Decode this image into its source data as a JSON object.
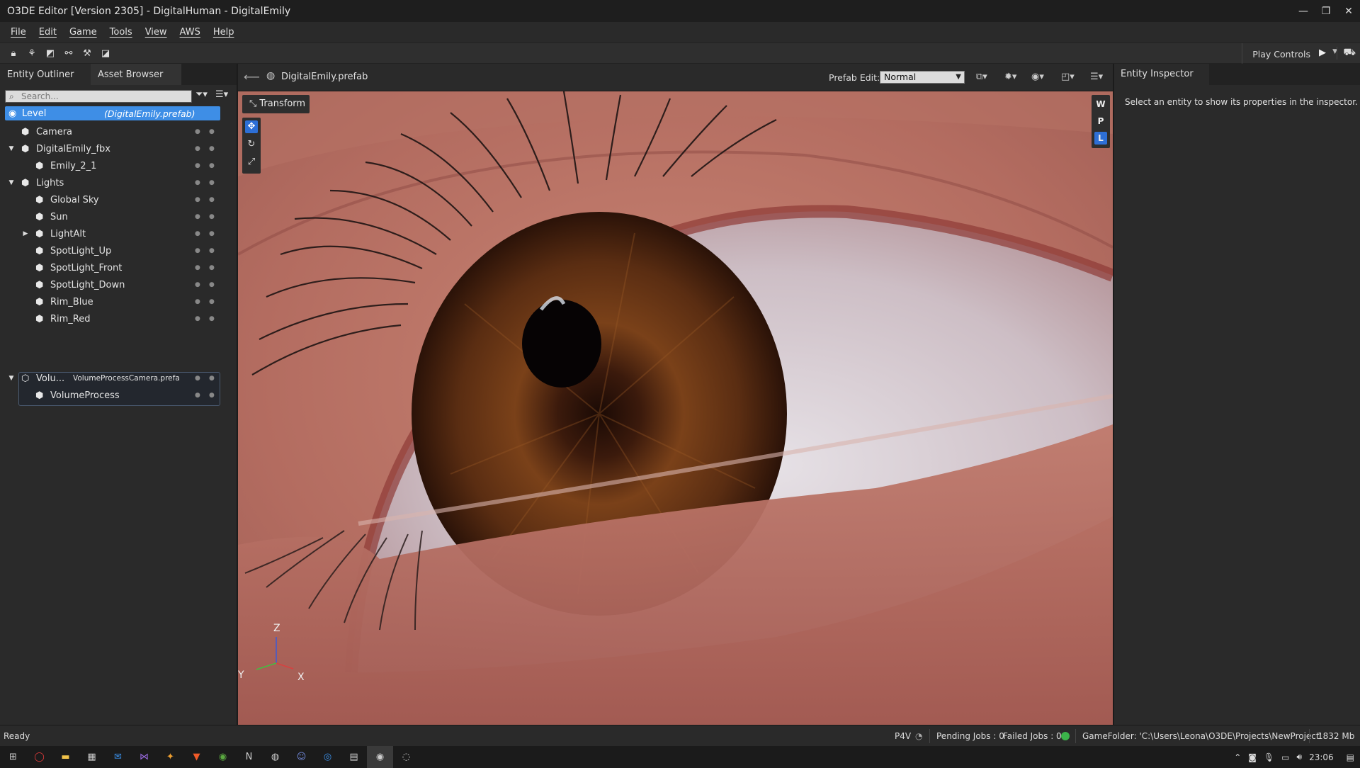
{
  "window": {
    "title": "O3DE Editor [Version 2305] - DigitalHuman - DigitalEmily",
    "controls": [
      "—",
      "❐",
      "✕"
    ]
  },
  "menu": [
    "File",
    "Edit",
    "Game",
    "Tools",
    "View",
    "AWS",
    "Help"
  ],
  "toolbar": {
    "play_controls_label": "Play Controls"
  },
  "left_panel": {
    "tabs": [
      "Entity Outliner",
      "Asset Browser"
    ],
    "search_placeholder": "Search...",
    "level": {
      "label": "Level",
      "prefab": "(DigitalEmily.prefab)"
    },
    "entities": [
      {
        "label": "Camera",
        "indent": 0,
        "expander": ""
      },
      {
        "label": "DigitalEmily_fbx",
        "indent": 0,
        "expander": "▼"
      },
      {
        "label": "Emily_2_1",
        "indent": 1,
        "expander": ""
      },
      {
        "label": "Lights",
        "indent": 0,
        "expander": "▼"
      },
      {
        "label": "Global Sky",
        "indent": 1,
        "expander": ""
      },
      {
        "label": "Sun",
        "indent": 1,
        "expander": ""
      },
      {
        "label": "LightAlt",
        "indent": 1,
        "expander": "▶"
      },
      {
        "label": "SpotLight_Up",
        "indent": 1,
        "expander": ""
      },
      {
        "label": "SpotLight_Front",
        "indent": 1,
        "expander": ""
      },
      {
        "label": "SpotLight_Down",
        "indent": 1,
        "expander": ""
      },
      {
        "label": "Rim_Blue",
        "indent": 1,
        "expander": ""
      },
      {
        "label": "Rim_Red",
        "indent": 1,
        "expander": ""
      }
    ],
    "volume_group": {
      "label": "Volu...",
      "prefab": "VolumeProcessCamera.prefa",
      "child": "VolumeProcess"
    }
  },
  "viewport": {
    "prefab_name": "DigitalEmily.prefab",
    "prefab_edit_label": "Prefab Edit:",
    "prefab_edit_value": "Normal",
    "transform_label": "Transform",
    "space_buttons": [
      "W",
      "P",
      "L"
    ],
    "active_space": "L",
    "axis_labels": {
      "z": "Z",
      "y": "Y",
      "x": "X"
    }
  },
  "right_panel": {
    "tab": "Entity Inspector",
    "message": "Select an entity to show its properties in the inspector."
  },
  "status": {
    "ready": "Ready",
    "p4v": "P4V",
    "pending": "Pending Jobs : 0",
    "failed": "Failed Jobs : 0",
    "game_folder": "GameFolder: 'C:\\Users\\Leona\\O3DE\\Projects\\NewProject'",
    "memory": "1832 Mb"
  },
  "taskbar": {
    "time": "23:06"
  }
}
